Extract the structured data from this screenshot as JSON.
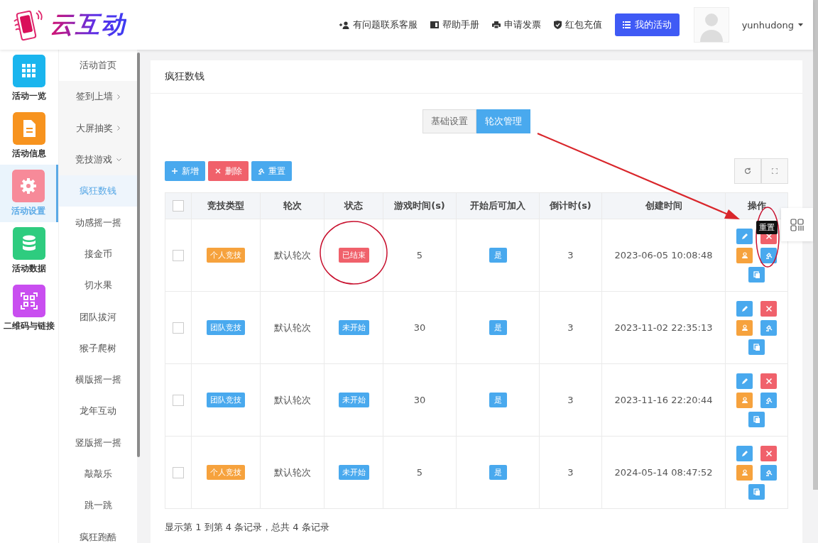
{
  "logo": {
    "text": "云互动"
  },
  "header": {
    "links": [
      {
        "kind": "user-plus",
        "label": "有问题联系客服"
      },
      {
        "kind": "book",
        "label": "帮助手册"
      },
      {
        "kind": "printer",
        "label": "申请发票"
      },
      {
        "kind": "shield",
        "label": "红包充值"
      }
    ],
    "primary_button": "我的活动",
    "username": "yunhudong"
  },
  "rail": [
    {
      "kind": "grid",
      "label": "活动一览",
      "selected": false
    },
    {
      "kind": "file",
      "label": "活动信息",
      "selected": false
    },
    {
      "kind": "gear",
      "label": "活动设置",
      "selected": true
    },
    {
      "kind": "database",
      "label": "活动数据",
      "selected": false
    },
    {
      "kind": "qr",
      "label": "二维码与链接",
      "selected": false
    }
  ],
  "submenu": [
    {
      "label": "活动首页",
      "kind": "link",
      "selected": false
    },
    {
      "label": "签到上墙",
      "kind": "collapsed",
      "selected": false
    },
    {
      "label": "大屏抽奖",
      "kind": "collapsed",
      "selected": false
    },
    {
      "label": "竞技游戏",
      "kind": "expanded",
      "selected": false
    },
    {
      "label": "疯狂数钱",
      "kind": "link",
      "selected": true
    },
    {
      "label": "动感摇一摇",
      "kind": "link",
      "selected": false
    },
    {
      "label": "接金币",
      "kind": "link",
      "selected": false
    },
    {
      "label": "切水果",
      "kind": "link",
      "selected": false
    },
    {
      "label": "团队拔河",
      "kind": "link",
      "selected": false
    },
    {
      "label": "猴子爬树",
      "kind": "link",
      "selected": false
    },
    {
      "label": "横版摇一摇",
      "kind": "link",
      "selected": false
    },
    {
      "label": "龙年互动",
      "kind": "link",
      "selected": false
    },
    {
      "label": "竖版摇一摇",
      "kind": "link",
      "selected": false
    },
    {
      "label": "敲敲乐",
      "kind": "link",
      "selected": false
    },
    {
      "label": "跳一跳",
      "kind": "link",
      "selected": false
    },
    {
      "label": "疯狂跑酷",
      "kind": "link",
      "selected": false
    }
  ],
  "card": {
    "title": "疯狂数钱",
    "tabs": [
      {
        "label": "基础设置",
        "selected": false
      },
      {
        "label": "轮次管理",
        "selected": true
      }
    ],
    "toolbar": [
      {
        "kind": "add",
        "label": "新增"
      },
      {
        "kind": "delete",
        "label": "删除"
      },
      {
        "kind": "reset",
        "label": "重置"
      }
    ],
    "table": {
      "columns": [
        "竞技类型",
        "轮次",
        "状态",
        "游戏时间(s)",
        "开始后可加入",
        "倒计时(s)",
        "创建时间",
        "操作"
      ],
      "header_checked": false,
      "rows": [
        {
          "checked": false,
          "type": {
            "text": "个人竞技",
            "kind": "personal"
          },
          "round": "默认轮次",
          "status": {
            "text": "已结束",
            "kind": "ended"
          },
          "game_time": "5",
          "join_after_start": "是",
          "countdown": "3",
          "created": "2023-06-05 10:08:48"
        },
        {
          "checked": false,
          "type": {
            "text": "团队竞技",
            "kind": "team"
          },
          "round": "默认轮次",
          "status": {
            "text": "未开始",
            "kind": "pending"
          },
          "game_time": "30",
          "join_after_start": "是",
          "countdown": "3",
          "created": "2023-11-02 22:35:13"
        },
        {
          "checked": false,
          "type": {
            "text": "团队竞技",
            "kind": "team"
          },
          "round": "默认轮次",
          "status": {
            "text": "未开始",
            "kind": "pending"
          },
          "game_time": "30",
          "join_after_start": "是",
          "countdown": "3",
          "created": "2023-11-16 22:20:44"
        },
        {
          "checked": false,
          "type": {
            "text": "个人竞技",
            "kind": "personal"
          },
          "round": "默认轮次",
          "status": {
            "text": "未开始",
            "kind": "pending"
          },
          "game_time": "5",
          "join_after_start": "是",
          "countdown": "3",
          "created": "2024-05-14 08:47:52"
        }
      ]
    },
    "footer": "显示第 1 到第 4 条记录，总共 4 条记录"
  },
  "tooltip": "重置"
}
